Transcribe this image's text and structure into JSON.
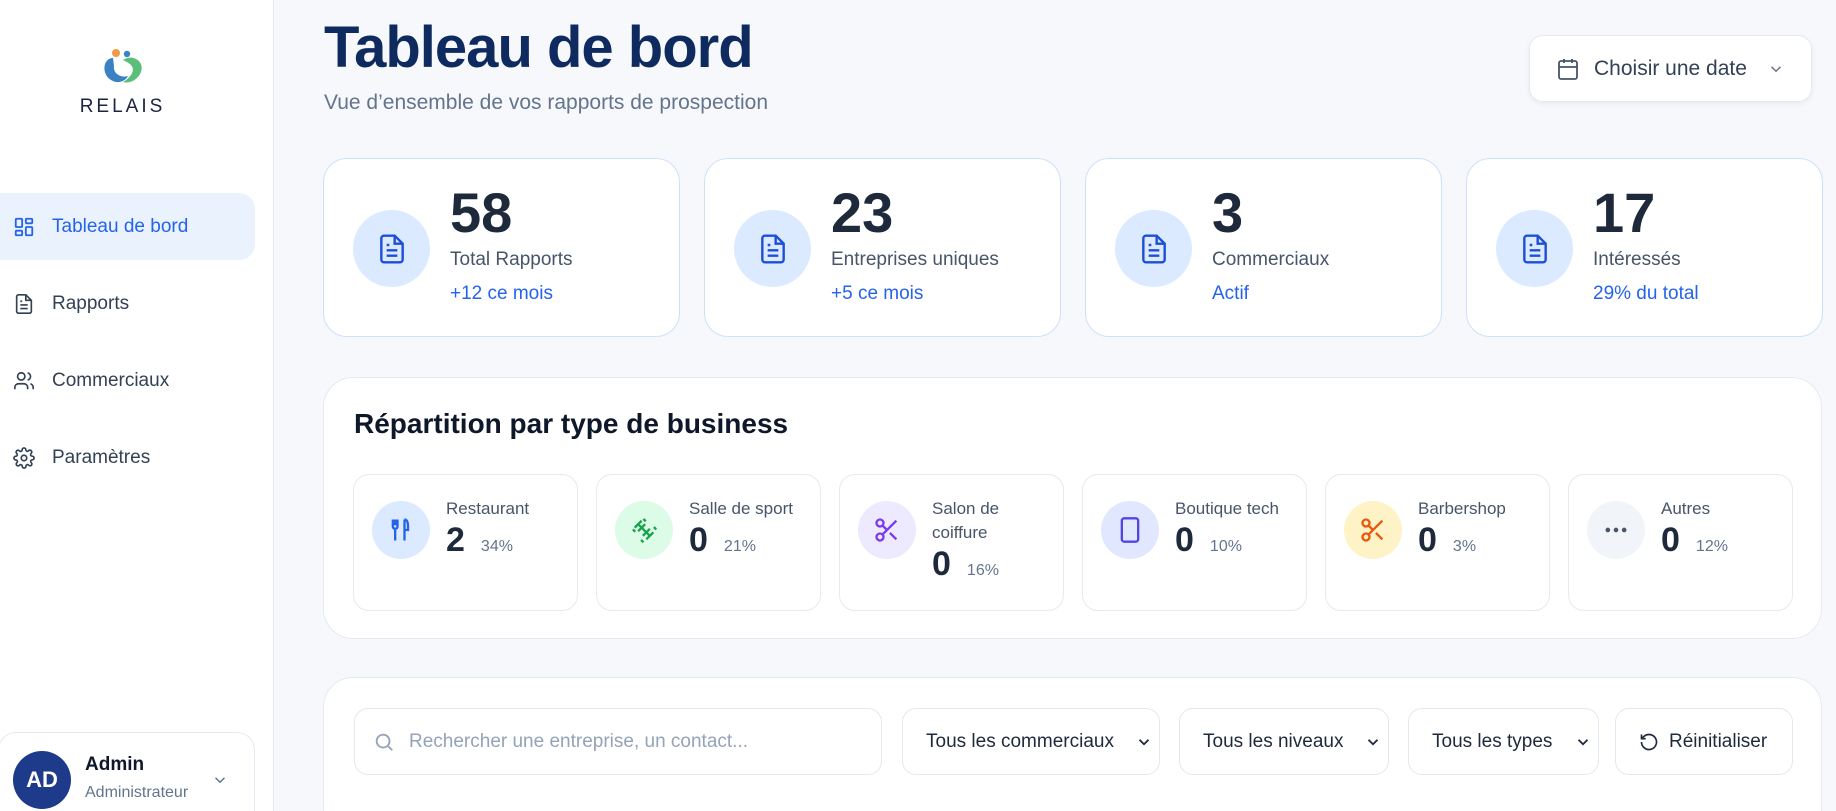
{
  "brand": {
    "name": "RELAIS"
  },
  "sidebar": {
    "items": [
      {
        "label": "Tableau de bord",
        "icon": "dashboard-icon",
        "active": true
      },
      {
        "label": "Rapports",
        "icon": "document-icon",
        "active": false
      },
      {
        "label": "Commerciaux",
        "icon": "users-icon",
        "active": false
      },
      {
        "label": "Paramètres",
        "icon": "gear-icon",
        "active": false
      }
    ],
    "user": {
      "initials": "AD",
      "name": "Admin",
      "role": "Administrateur"
    }
  },
  "header": {
    "title": "Tableau de bord",
    "subtitle": "Vue d’ensemble de vos rapports de prospection",
    "date_picker_label": "Choisir une date"
  },
  "stats": [
    {
      "value": "58",
      "label": "Total Rapports",
      "sub": "+12 ce mois"
    },
    {
      "value": "23",
      "label": "Entreprises uniques",
      "sub": "+5 ce mois"
    },
    {
      "value": "3",
      "label": "Commerciaux",
      "sub": "Actif"
    },
    {
      "value": "17",
      "label": "Intéressés",
      "sub": "29% du total"
    }
  ],
  "business": {
    "title": "Répartition par type de business",
    "types": [
      {
        "name": "Restaurant",
        "count": "2",
        "pct": "34%",
        "icon": "utensils-icon",
        "bg": "#dbeafe",
        "color": "#2563eb"
      },
      {
        "name": "Salle de sport",
        "count": "0",
        "pct": "21%",
        "icon": "dumbbell-icon",
        "bg": "#dcfce7",
        "color": "#16a34a"
      },
      {
        "name": "Salon de coiffure",
        "count": "0",
        "pct": "16%",
        "icon": "scissors-icon",
        "bg": "#ede9fe",
        "color": "#7c3aed"
      },
      {
        "name": "Boutique tech",
        "count": "0",
        "pct": "10%",
        "icon": "tablet-icon",
        "bg": "#e0e7ff",
        "color": "#4f46e5"
      },
      {
        "name": "Barbershop",
        "count": "0",
        "pct": "3%",
        "icon": "scissors-icon",
        "bg": "#fef3c7",
        "color": "#ea580c"
      },
      {
        "name": "Autres",
        "count": "0",
        "pct": "12%",
        "icon": "more-icon",
        "bg": "#f1f5f9",
        "color": "#475569"
      }
    ]
  },
  "filters": {
    "search_placeholder": "Rechercher une entreprise, un contact...",
    "commerciaux": "Tous les commerciaux",
    "niveaux": "Tous les niveaux",
    "types": "Tous les types",
    "reset_label": "Réinitialiser"
  },
  "colors": {
    "accent": "#2563eb",
    "title": "#0f2a5e",
    "avatar": "#1e3a8a"
  }
}
